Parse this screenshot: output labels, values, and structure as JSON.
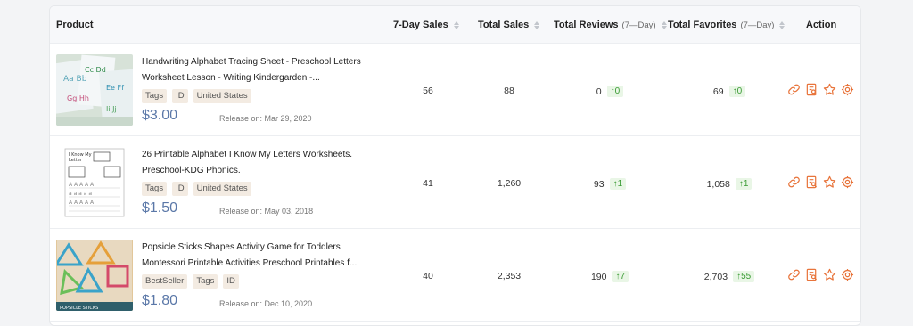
{
  "table": {
    "headers": {
      "product": "Product",
      "sales7": "7-Day Sales",
      "total_sales": "Total Sales",
      "total_reviews": "Total Reviews",
      "total_reviews_sub": "(7—Day)",
      "total_favorites": "Total Favorites",
      "total_favorites_sub": "(7—Day)",
      "action": "Action"
    },
    "rows": [
      {
        "title": "Handwriting Alphabet Tracing Sheet - Preschool Letters Worksheet Lesson - Writing Kindergarden -...",
        "tags": [
          "Tags",
          "ID",
          "United States"
        ],
        "price": "$3.00",
        "release": "Release on: Mar 29, 2020",
        "sales7": "56",
        "total_sales": "88",
        "reviews": "0",
        "reviews_delta": "↑0",
        "favorites": "69",
        "favorites_delta": "↑0"
      },
      {
        "title": "26 Printable Alphabet I Know My Letters Worksheets. Preschool-KDG Phonics.",
        "tags": [
          "Tags",
          "ID",
          "United States"
        ],
        "price": "$1.50",
        "release": "Release on: May 03, 2018",
        "sales7": "41",
        "total_sales": "1,260",
        "reviews": "93",
        "reviews_delta": "↑1",
        "favorites": "1,058",
        "favorites_delta": "↑1"
      },
      {
        "title": "Popsicle Sticks Shapes Activity Game for Toddlers Montessori Printable Activities Preschool Printables f...",
        "tags": [
          "BestSeller",
          "Tags",
          "ID"
        ],
        "price": "$1.80",
        "release": "Release on: Dec 10, 2020",
        "sales7": "40",
        "total_sales": "2,353",
        "reviews": "190",
        "reviews_delta": "↑7",
        "favorites": "2,703",
        "favorites_delta": "↑55"
      }
    ]
  },
  "colors": {
    "price": "#5b78a8",
    "action_icons": "#e8743b",
    "delta_green": "#3a9b34",
    "tag_bg": "#f3ebe2"
  },
  "icons": [
    "link-icon",
    "report-icon",
    "star-icon",
    "settings-icon"
  ]
}
